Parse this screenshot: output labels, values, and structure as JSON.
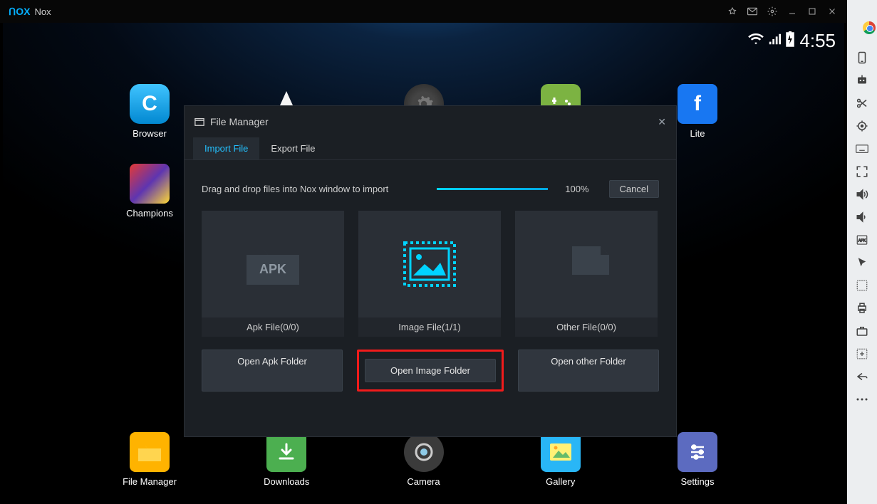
{
  "window": {
    "title": "Nox",
    "logo_text": "ᑎOX"
  },
  "status": {
    "clock": "4:55"
  },
  "home": {
    "top_row": [
      {
        "label": "Browser"
      },
      {
        "label": ""
      },
      {
        "label": ""
      },
      {
        "label": ""
      },
      {
        "label": "Lite"
      }
    ],
    "left_col_second": {
      "label": "Champions"
    },
    "bottom_row": [
      {
        "label": "File Manager"
      },
      {
        "label": "Downloads"
      },
      {
        "label": "Camera"
      },
      {
        "label": "Gallery"
      },
      {
        "label": "Settings"
      }
    ]
  },
  "modal": {
    "title": "File Manager",
    "tabs": {
      "import": "Import File",
      "export": "Export File"
    },
    "drop_text": "Drag and drop files into Nox window to import",
    "progress_pct": "100%",
    "cancel": "Cancel",
    "cards": {
      "apk": "Apk File(0/0)",
      "image": "Image File(1/1)",
      "other": "Other File(0/0)"
    },
    "buttons": {
      "open_apk": "Open Apk Folder",
      "open_image": "Open Image Folder",
      "open_other": "Open other Folder"
    }
  }
}
